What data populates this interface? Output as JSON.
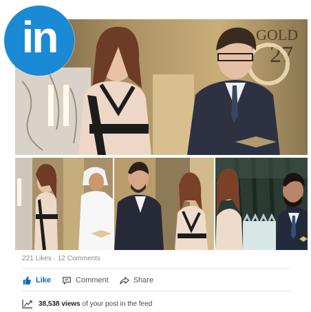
{
  "logo": {
    "text": "in",
    "color": "#1a8ad4"
  },
  "photos": {
    "main_sign_text": "GOLD",
    "main_sign_number": "27"
  },
  "post": {
    "likes": "221 Likes",
    "separator": "·",
    "comments": "12 Comments",
    "actions": {
      "like": "Like",
      "comment": "Comment",
      "share": "Share"
    },
    "views_count": "38,538 views",
    "views_suffix": "of your post in the feed"
  },
  "colors": {
    "accent": "#0a66c2",
    "gold": "#b89a5a"
  },
  "icons": [
    "like-icon",
    "comment-icon",
    "share-icon",
    "analytics-icon"
  ]
}
